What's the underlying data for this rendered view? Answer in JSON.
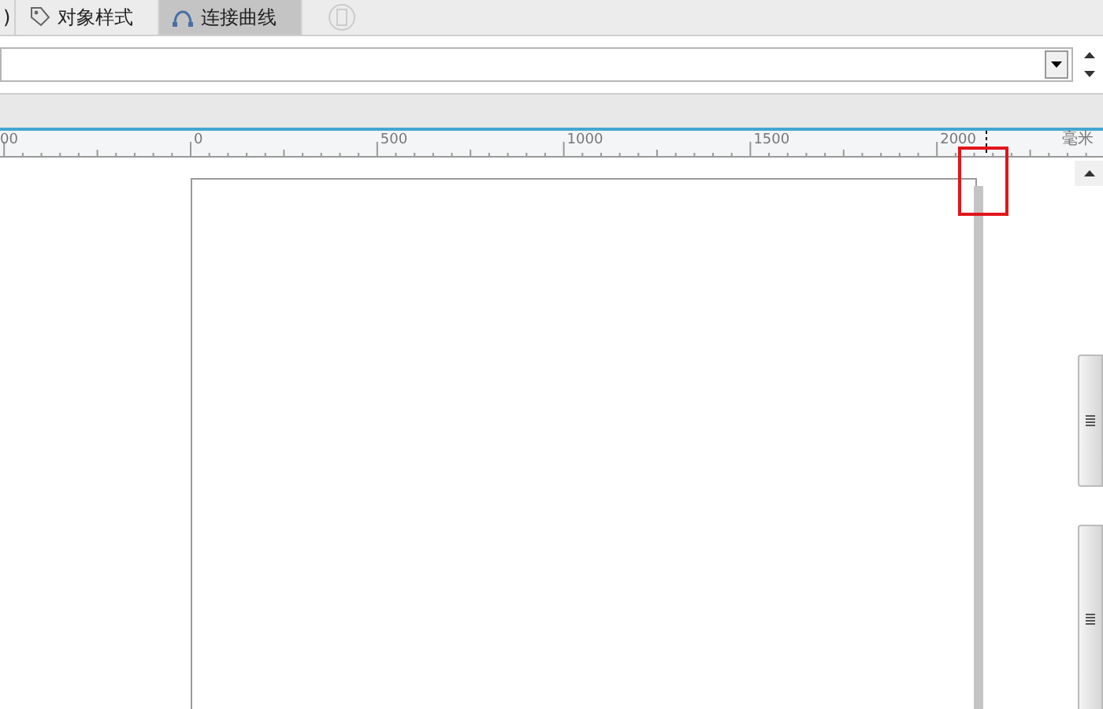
{
  "tabs": [
    {
      "label": ")",
      "selected": false,
      "kind": "cut"
    },
    {
      "label": "对象样式",
      "selected": false,
      "kind": "tab"
    },
    {
      "label": "连接曲线",
      "selected": true,
      "kind": "tab"
    },
    {
      "selected": false,
      "kind": "disabled-icon"
    }
  ],
  "ruler": {
    "labels": [
      {
        "label": "00"
      },
      {
        "label": "0"
      },
      {
        "label": "500"
      },
      {
        "label": "1000"
      },
      {
        "label": "1500"
      },
      {
        "label": "2000"
      }
    ],
    "unit": "毫米"
  }
}
